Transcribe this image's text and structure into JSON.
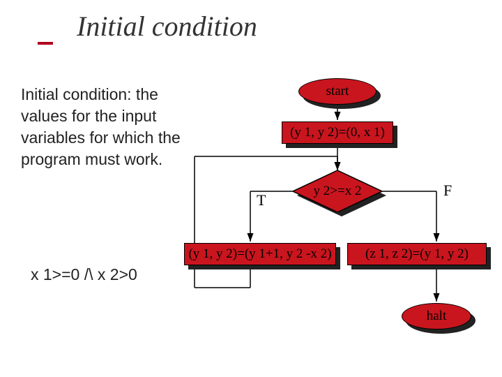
{
  "title": "Initial condition",
  "body_text": "Initial condition: the values for the input variables for which the program must work.",
  "condition_expr": "x 1>=0 /\\ x 2>0",
  "flow": {
    "start": "start",
    "init": "(y 1, y 2)=(0, x 1)",
    "test": "y 2>=x 2",
    "true_branch": "(y 1, y 2)=(y 1+1, y 2 -x 2)",
    "false_branch": "(z 1, z 2)=(y 1, y 2)",
    "halt": "halt",
    "T": "T",
    "F": "F"
  }
}
